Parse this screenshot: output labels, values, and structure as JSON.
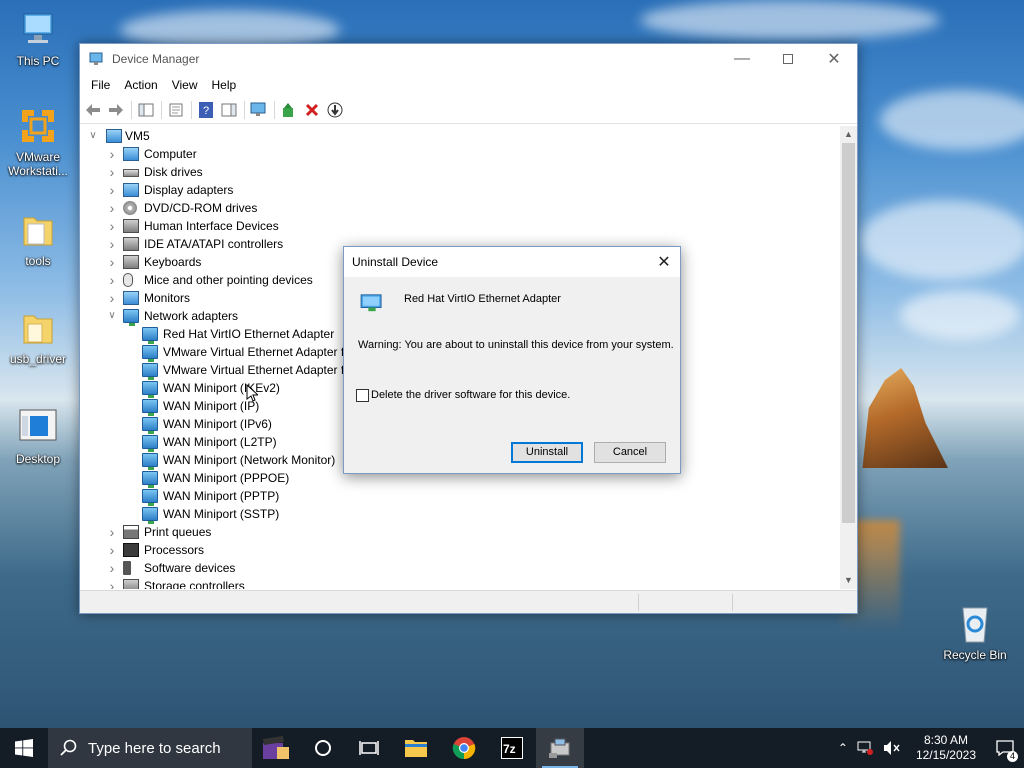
{
  "desktop": {
    "icons": [
      {
        "label": "This PC"
      },
      {
        "label": "VMware Workstati..."
      },
      {
        "label": "tools"
      },
      {
        "label": "usb_driver"
      },
      {
        "label": "Desktop"
      },
      {
        "label": "Recycle Bin"
      }
    ]
  },
  "window": {
    "title": "Device Manager",
    "menu": [
      "File",
      "Action",
      "View",
      "Help"
    ],
    "tree": {
      "root": "VM5",
      "categories": [
        {
          "label": "Computer",
          "icon": "computer-icon"
        },
        {
          "label": "Disk drives",
          "icon": "disk-drive-icon"
        },
        {
          "label": "Display adapters",
          "icon": "display-adapter-icon"
        },
        {
          "label": "DVD/CD-ROM drives",
          "icon": "dvd-icon"
        },
        {
          "label": "Human Interface Devices",
          "icon": "hid-icon"
        },
        {
          "label": "IDE ATA/ATAPI controllers",
          "icon": "ide-controller-icon"
        },
        {
          "label": "Keyboards",
          "icon": "keyboard-icon"
        },
        {
          "label": "Mice and other pointing devices",
          "icon": "mouse-icon"
        },
        {
          "label": "Monitors",
          "icon": "monitor-icon"
        },
        {
          "label": "Network adapters",
          "icon": "network-adapter-icon",
          "expanded": true
        }
      ],
      "network_children": [
        "Red Hat VirtIO Ethernet Adapter",
        "VMware Virtual Ethernet Adapter fo",
        "VMware Virtual Ethernet Adapter fo",
        "WAN Miniport (IKEv2)",
        "WAN Miniport (IP)",
        "WAN Miniport (IPv6)",
        "WAN Miniport (L2TP)",
        "WAN Miniport (Network Monitor)",
        "WAN Miniport (PPPOE)",
        "WAN Miniport (PPTP)",
        "WAN Miniport (SSTP)"
      ],
      "more_categories": [
        {
          "label": "Print queues",
          "icon": "printer-icon"
        },
        {
          "label": "Processors",
          "icon": "processor-icon"
        },
        {
          "label": "Software devices",
          "icon": "software-device-icon"
        },
        {
          "label": "Storage controllers",
          "icon": "storage-controller-icon"
        }
      ]
    }
  },
  "dialog": {
    "title": "Uninstall Device",
    "device_name": "Red Hat VirtIO Ethernet Adapter",
    "warning": "Warning: You are about to uninstall this device from your system.",
    "checkbox_label": "Delete the driver software for this device.",
    "checkbox_checked": false,
    "uninstall_label": "Uninstall",
    "cancel_label": "Cancel"
  },
  "taskbar": {
    "search_placeholder": "Type here to search",
    "time": "8:30 AM",
    "date": "12/15/2023",
    "notification_count": "4"
  }
}
